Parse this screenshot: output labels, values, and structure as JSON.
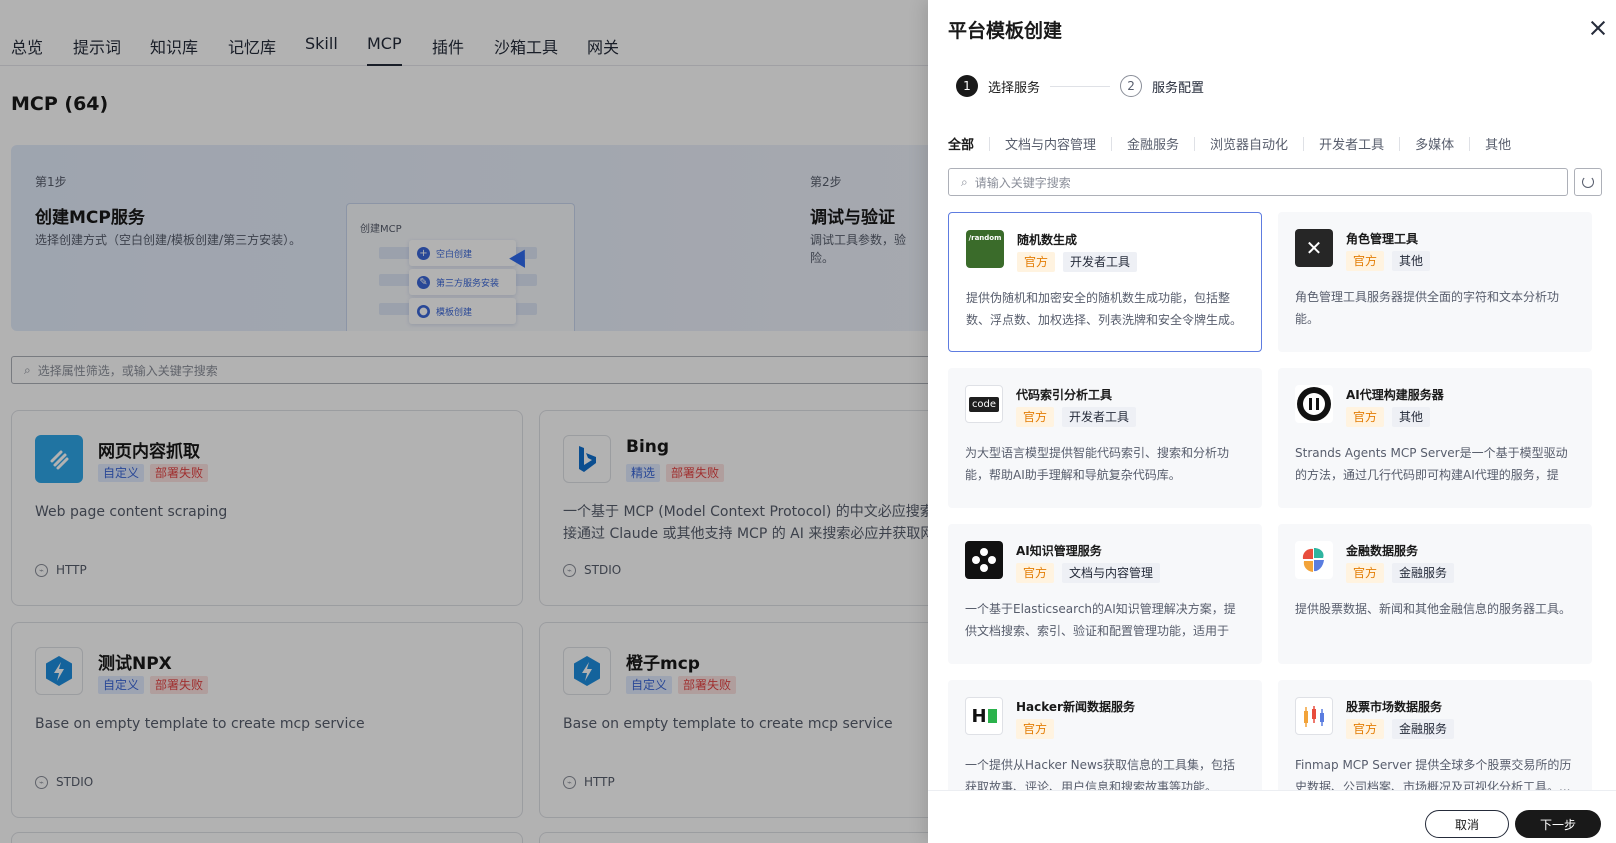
{
  "top_tabs": [
    "总览",
    "提示词",
    "知识库",
    "记忆库",
    "Skill",
    "MCP",
    "插件",
    "沙箱工具",
    "网关"
  ],
  "page_title": "MCP (64)",
  "guide": {
    "step1_tag": "第1步",
    "step1_title": "创建MCP服务",
    "step1_desc": "选择创建方式（空白创建/模板创建/第三方安装）。",
    "mock_title": "创建MCP",
    "mock_options": [
      "空白创建",
      "第三方服务安装",
      "模板创建"
    ],
    "step2_tag": "第2步",
    "step2_title": "调试与验证",
    "step2_desc": "调试工具参数，验\n险。"
  },
  "filter_placeholder": "选择属性筛选，或输入关键字搜索",
  "cards": [
    {
      "name": "网页内容抓取",
      "tag1": "自定义",
      "tag2": "部署失败",
      "desc": "Web page content scraping",
      "protocol": "HTTP"
    },
    {
      "name": "Bing",
      "tag1": "精选",
      "tag2": "部署失败",
      "desc": "一个基于 MCP (Model Context Protocol) 的中文必应搜索\n接通过 Claude 或其他支持 MCP 的 AI 来搜索必应并获取网",
      "protocol": "STDIO"
    },
    {
      "name": "测试NPX",
      "tag1": "自定义",
      "tag2": "部署失败",
      "desc": "Base on empty template to create mcp service",
      "protocol": "STDIO"
    },
    {
      "name": "橙子mcp",
      "tag1": "自定义",
      "tag2": "部署失败",
      "desc": "Base on empty template to create mcp service",
      "protocol": "HTTP"
    }
  ],
  "drawer": {
    "title": "平台模板创建",
    "steps": [
      {
        "num": "1",
        "label": "选择服务"
      },
      {
        "num": "2",
        "label": "服务配置"
      }
    ],
    "categories": [
      "全部",
      "文档与内容管理",
      "金融服务",
      "浏览器自动化",
      "开发者工具",
      "多媒体",
      "其他"
    ],
    "search_placeholder": "请输入关键字搜索",
    "services": [
      {
        "name": "随机数生成",
        "tag": "官方",
        "category": "开发者工具",
        "desc": "提供伪随机和加密安全的随机数生成功能，包括整数、浮点数、加权选择、列表洗牌和安全令牌生成。",
        "logo_text": "/random"
      },
      {
        "name": "角色管理工具",
        "tag": "官方",
        "category": "其他",
        "desc": "角色管理工具服务器提供全面的字符和文本分析功能。",
        "logo_text": ""
      },
      {
        "name": "代码索引分析工具",
        "tag": "官方",
        "category": "开发者工具",
        "desc": "为大型语言模型提供智能代码索引、搜索和分析功能，帮助AI助手理解和导航复杂代码库。",
        "logo_text": "code"
      },
      {
        "name": "AI代理构建服务器",
        "tag": "官方",
        "category": "其他",
        "desc": "Strands Agents MCP Server是一个基于模型驱动的方法，通过几行代码即可构建AI代理的服务，提供...",
        "logo_text": ""
      },
      {
        "name": "AI知识管理服务",
        "tag": "官方",
        "category": "文档与内容管理",
        "desc": "一个基于Elasticsearch的AI知识管理解决方案，提供文档搜索、索引、验证和配置管理功能，适用于各...",
        "logo_text": ""
      },
      {
        "name": "金融数据服务",
        "tag": "官方",
        "category": "金融服务",
        "desc": "提供股票数据、新闻和其他金融信息的服务器工具。",
        "logo_text": ""
      },
      {
        "name": "Hacker新闻数据服务",
        "tag": "官方",
        "category": "",
        "desc": "一个提供从Hacker News获取信息的工具集，包括获取故事、评论、用户信息和搜索故事等功能。",
        "logo_text": "H"
      },
      {
        "name": "股票市场数据服务",
        "tag": "官方",
        "category": "金融服务",
        "desc": "Finmap MCP Server 提供全球多个股票交易所的历史数据、公司档案、市场概况及可视化分析工具。...",
        "logo_text": ""
      }
    ],
    "cancel_label": "取消",
    "next_label": "下一步"
  },
  "colors": {
    "accent": "#5e7ce0",
    "official_tag": "#e37d05",
    "primary_button": "#191919"
  }
}
